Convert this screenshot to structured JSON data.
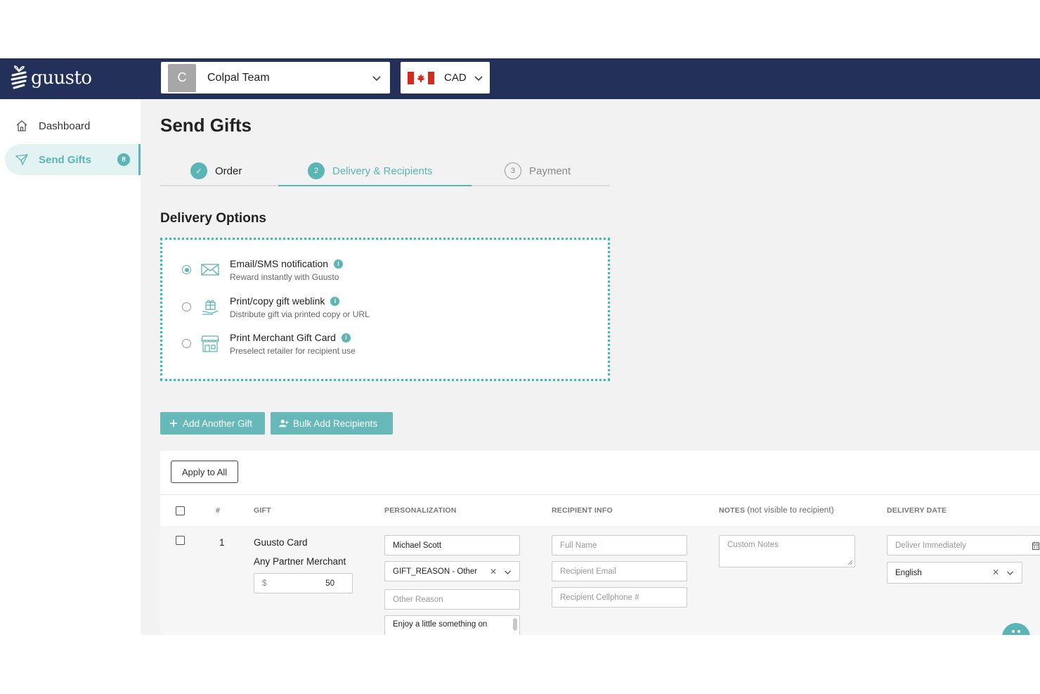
{
  "header": {
    "brand": "guusto",
    "team": {
      "avatar_letter": "C",
      "name": "Colpal Team"
    },
    "currency": {
      "code": "CAD"
    }
  },
  "sidebar": {
    "items": [
      {
        "label": "Dashboard",
        "icon": "home-icon"
      },
      {
        "label": "Send Gifts",
        "icon": "send-icon",
        "badge": "8",
        "active": true
      }
    ]
  },
  "page": {
    "title": "Send Gifts",
    "steps": [
      {
        "label": "Order",
        "marker": "✓",
        "state": "done"
      },
      {
        "label": "Delivery & Recipients",
        "marker": "2",
        "state": "active"
      },
      {
        "label": "Payment",
        "marker": "3",
        "state": "pending"
      }
    ]
  },
  "delivery": {
    "title": "Delivery Options",
    "options": [
      {
        "title": "Email/SMS notification",
        "subtitle": "Reward instantly with Guusto",
        "selected": true,
        "icon": "envelope-icon"
      },
      {
        "title": "Print/copy gift weblink",
        "subtitle": "Distribute gift via printed copy or URL",
        "selected": false,
        "icon": "gift-hand-icon"
      },
      {
        "title": "Print Merchant Gift Card",
        "subtitle": "Preselect retailer for recipient use",
        "selected": false,
        "icon": "storefront-icon"
      }
    ]
  },
  "actions": {
    "add_gift": "Add Another Gift",
    "bulk_add": "Bulk Add Recipients"
  },
  "table": {
    "apply_all": "Apply to All",
    "headers": {
      "num": "#",
      "gift": "GIFT",
      "personalization": "PERSONALIZATION",
      "recipient": "RECIPIENT INFO",
      "notes": "NOTES",
      "notes_hint": "(not visible to recipient)",
      "delivery_date": "DELIVERY DATE"
    },
    "row": {
      "num": "1",
      "gift_name": "Guusto Card",
      "merchant": "Any Partner Merchant",
      "currency_symbol": "$",
      "amount": "50",
      "from_name": "Michael Scott",
      "reason": "GIFT_REASON - Other",
      "other_reason_placeholder": "Other Reason",
      "message": "Enjoy a little something on",
      "full_name_placeholder": "Full Name",
      "email_placeholder": "Recipient Email",
      "phone_placeholder": "Recipient Cellphone #",
      "notes_placeholder": "Custom Notes",
      "date_placeholder": "Deliver Immediately",
      "language": "English"
    }
  },
  "colors": {
    "navbar": "#233059",
    "accent": "#5bb5b4",
    "focus_border": "#2cc2c4"
  }
}
